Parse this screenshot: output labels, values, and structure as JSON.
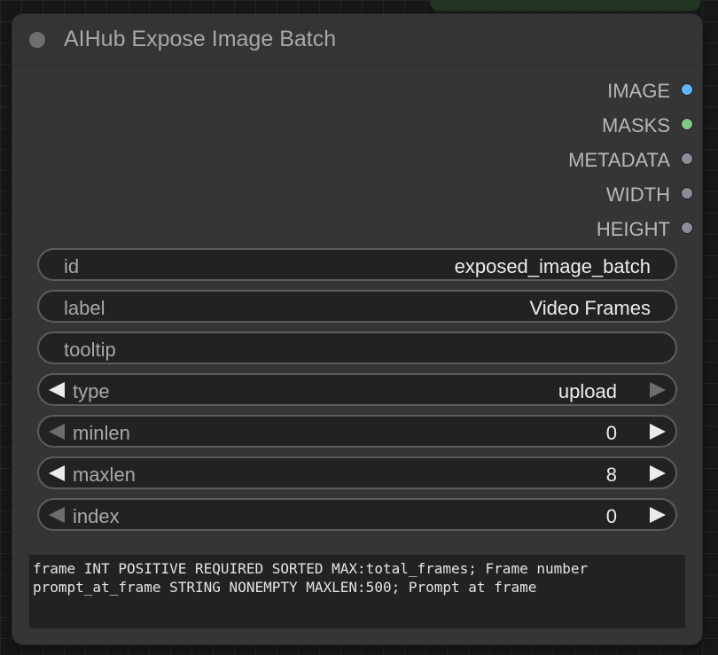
{
  "node": {
    "title": "AIHub Expose Image Batch"
  },
  "outputs": [
    {
      "label": "IMAGE",
      "color": "#64b5f6"
    },
    {
      "label": "MASKS",
      "color": "#81c784"
    },
    {
      "label": "METADATA",
      "color": "#8e8a9a"
    },
    {
      "label": "WIDTH",
      "color": "#8e8a9a"
    },
    {
      "label": "HEIGHT",
      "color": "#8e8a9a"
    }
  ],
  "widgets": {
    "id": {
      "name": "id",
      "value": "exposed_image_batch"
    },
    "label": {
      "name": "label",
      "value": "Video Frames"
    },
    "tooltip": {
      "name": "tooltip",
      "value": ""
    },
    "type": {
      "name": "type",
      "value": "upload"
    },
    "minlen": {
      "name": "minlen",
      "value": "0"
    },
    "maxlen": {
      "name": "maxlen",
      "value": "8"
    },
    "index": {
      "name": "index",
      "value": "0"
    }
  },
  "metadata_text": "frame INT POSITIVE REQUIRED SORTED MAX:total_frames; Frame number\nprompt_at_frame STRING NONEMPTY MAXLEN:500; Prompt at frame",
  "icons": {
    "collapse": "circle-dot-icon",
    "decrement": "triangle-left-icon",
    "increment": "triangle-right-icon"
  }
}
